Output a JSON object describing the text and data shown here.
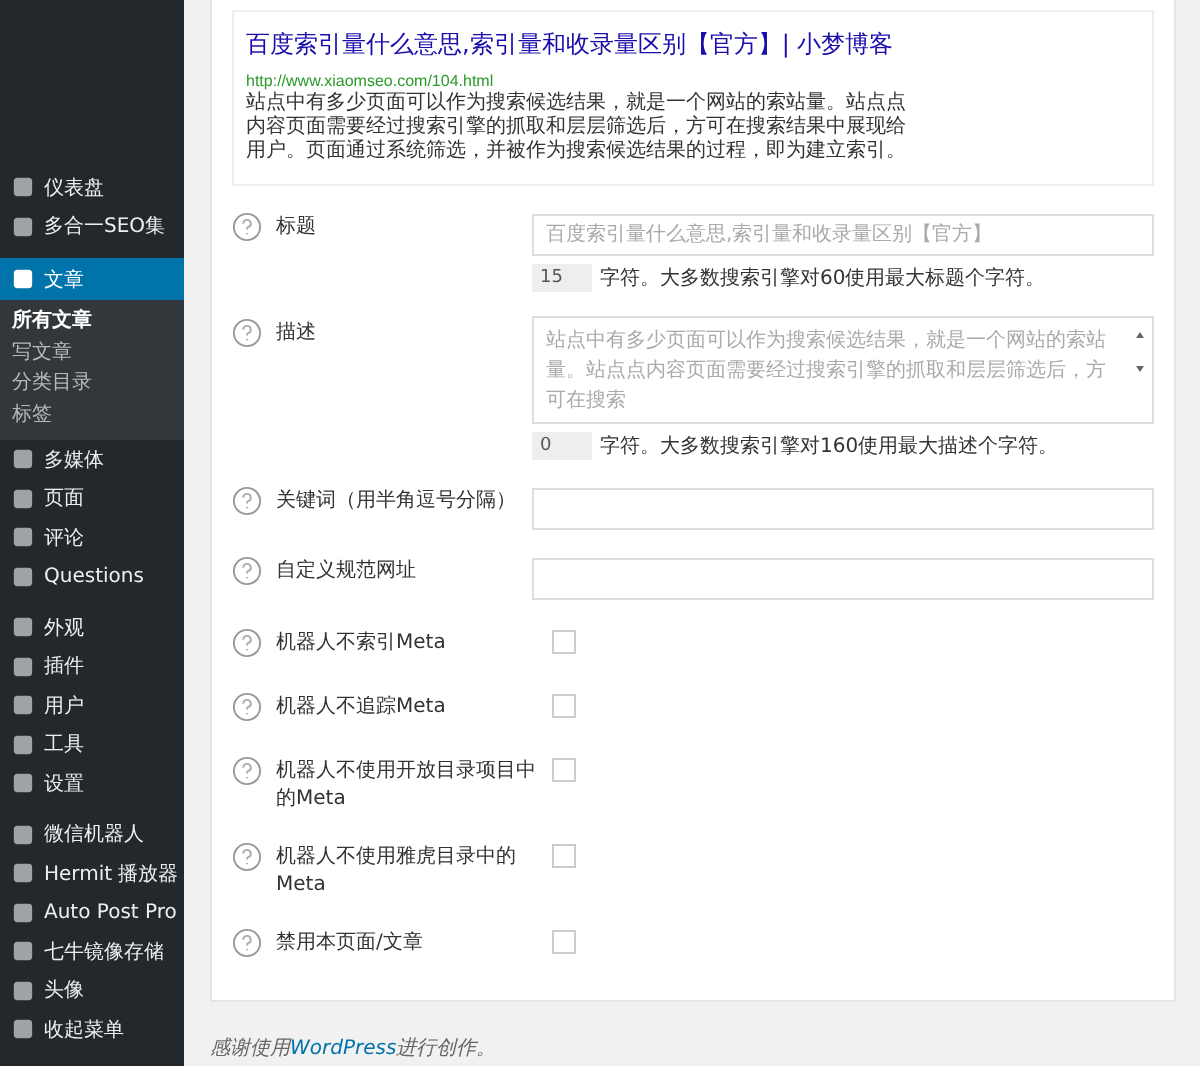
{
  "sidebar": {
    "groups": [
      {
        "items": [
          {
            "label": "仪表盘",
            "selected": false
          },
          {
            "label": "多合一SEO集",
            "selected": false
          }
        ]
      },
      {
        "items": [
          {
            "label": "文章",
            "selected": true,
            "children": [
              {
                "label": "所有文章",
                "selected": true
              },
              {
                "label": "写文章",
                "selected": false
              },
              {
                "label": "分类目录",
                "selected": false
              },
              {
                "label": "标签",
                "selected": false
              }
            ]
          },
          {
            "label": "多媒体",
            "selected": false
          },
          {
            "label": "页面",
            "selected": false
          },
          {
            "label": "评论",
            "selected": false
          },
          {
            "label": "Questions",
            "selected": false
          }
        ]
      },
      {
        "items": [
          {
            "label": "外观",
            "selected": false
          },
          {
            "label": "插件",
            "selected": false
          },
          {
            "label": "用户",
            "selected": false
          },
          {
            "label": "工具",
            "selected": false
          },
          {
            "label": "设置",
            "selected": false
          }
        ]
      },
      {
        "items": [
          {
            "label": "微信机器人",
            "selected": false
          },
          {
            "label": "Hermit 播放器",
            "selected": false
          },
          {
            "label": "Auto Post Pro",
            "selected": false
          },
          {
            "label": "七牛镜像存储",
            "selected": false
          },
          {
            "label": "头像",
            "selected": false
          },
          {
            "label": "收起菜单",
            "selected": false
          }
        ]
      }
    ]
  },
  "snippet": {
    "title": "百度索引量什么意思,索引量和收录量区别【官方】| 小梦博客",
    "url": "http://www.xiaomseo.com/104.html",
    "description": "站点中有多少页面可以作为搜索候选结果，就是一个网站的索站量。站点点内容页面需要经过搜索引擎的抓取和层层筛选后，方可在搜索结果中展现给用户。页面通过系统筛选，并被作为搜索候选结果的过程，即为建立索引。"
  },
  "fields": [
    {
      "kind": "text",
      "label": "标题",
      "placeholder": "百度索引量什么意思,索引量和收录量区别【官方】",
      "counter": {
        "value": "15",
        "note": "字符。大多数搜索引擎对60使用最大标题个字符。"
      }
    },
    {
      "kind": "textarea",
      "label": "描述",
      "placeholder": "站点中有多少页面可以作为搜索候选结果，就是一个网站的索站量。站点点内容页面需要经过搜索引擎的抓取和层层筛选后，方可在搜索",
      "counter": {
        "value": "0",
        "note": "字符。大多数搜索引擎对160使用最大描述个字符。"
      }
    },
    {
      "kind": "text",
      "label": "关键词（用半角逗号分隔）"
    },
    {
      "kind": "text",
      "label": "自定义规范网址"
    },
    {
      "kind": "checkbox",
      "label": "机器人不索引Meta",
      "checked": false
    },
    {
      "kind": "checkbox",
      "label": "机器人不追踪Meta",
      "checked": false
    },
    {
      "kind": "checkbox",
      "label": "机器人不使用开放目录项目中的Meta",
      "checked": false
    },
    {
      "kind": "checkbox",
      "label": "机器人不使用雅虎目录中的Meta",
      "checked": false
    },
    {
      "kind": "checkbox",
      "label": "禁用本页面/文章",
      "checked": false
    }
  ],
  "footer": {
    "before": "感谢使用",
    "link": "WordPress",
    "after": "进行创作。"
  }
}
